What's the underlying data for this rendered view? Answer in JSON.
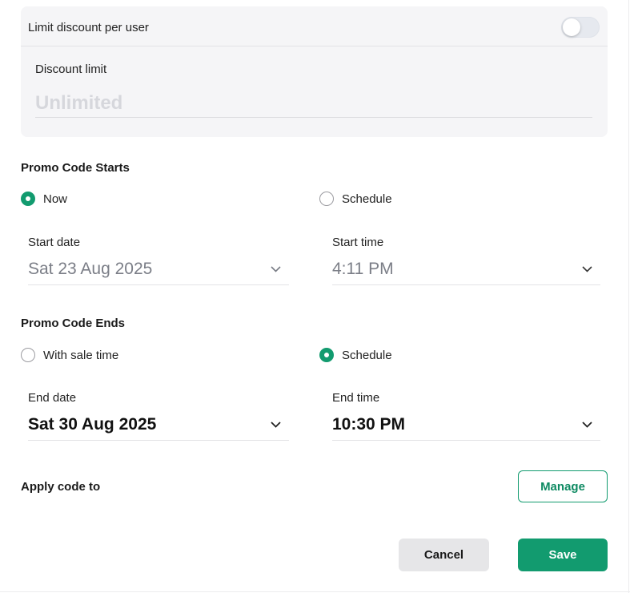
{
  "limit_section": {
    "toggle_label": "Limit discount per user",
    "toggle_on": false,
    "discount_limit_label": "Discount limit",
    "discount_limit_placeholder": "Unlimited",
    "discount_limit_value": ""
  },
  "starts": {
    "title": "Promo Code Starts",
    "options": [
      {
        "label": "Now",
        "checked": true
      },
      {
        "label": "Schedule",
        "checked": false
      }
    ],
    "start_date_label": "Start date",
    "start_date_value": "Sat 23 Aug 2025",
    "start_time_label": "Start time",
    "start_time_value": "4:11 PM"
  },
  "ends": {
    "title": "Promo Code Ends",
    "options": [
      {
        "label": "With sale time",
        "checked": false
      },
      {
        "label": "Schedule",
        "checked": true
      }
    ],
    "end_date_label": "End date",
    "end_date_value": "Sat 30 Aug 2025",
    "end_time_label": "End time",
    "end_time_value": "10:30 PM"
  },
  "apply": {
    "label": "Apply code to",
    "manage_button": "Manage"
  },
  "actions": {
    "cancel": "Cancel",
    "save": "Save"
  },
  "colors": {
    "accent": "#129b6f",
    "panel_bg": "#f5f5f7",
    "cancel_bg": "#e6e6e8"
  },
  "icons": {
    "dropdown": "chevron-down-icon"
  }
}
